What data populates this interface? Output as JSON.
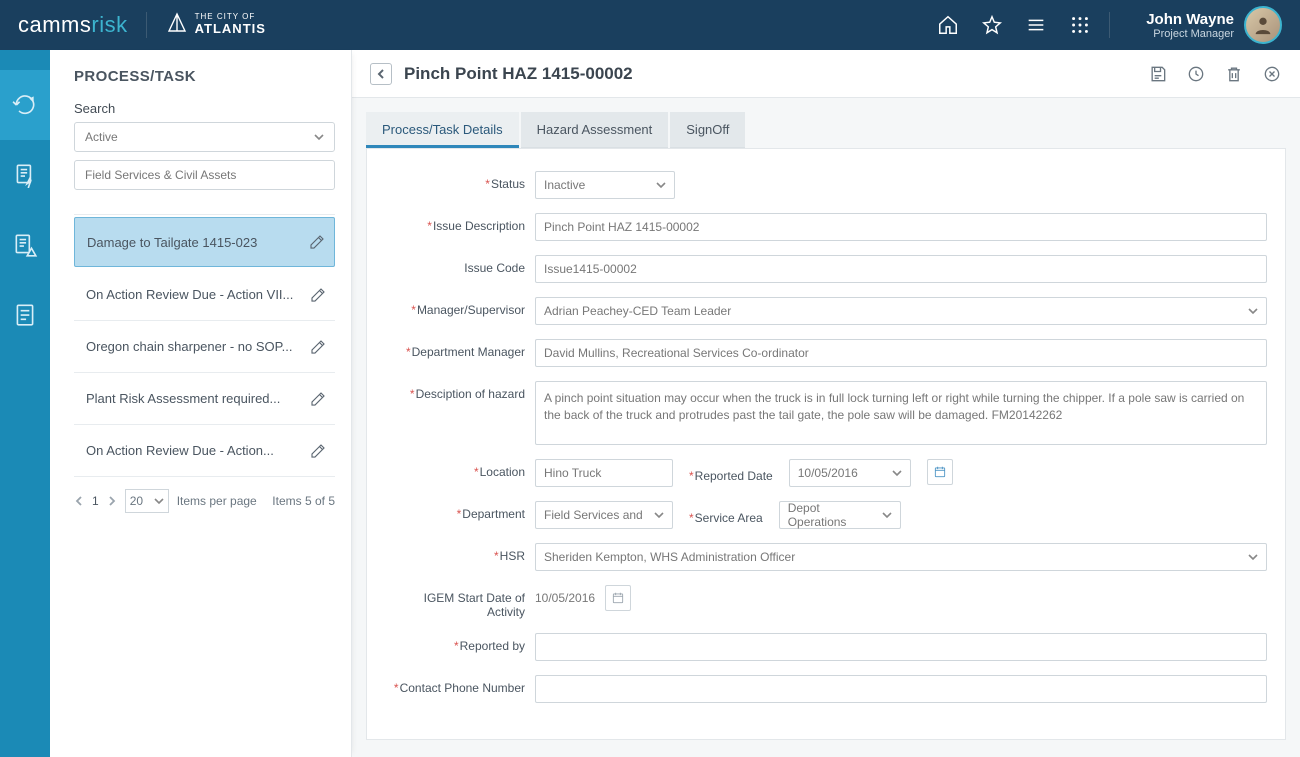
{
  "header": {
    "logo_left": "camms",
    "logo_right": "risk",
    "logo2_line1": "THE CITY OF",
    "logo2_line2": "ATLANTIS",
    "user_name": "John Wayne",
    "user_role": "Project Manager"
  },
  "sidebar": {
    "title": "PROCESS/TASK",
    "search_label": "Search",
    "status_filter": "Active",
    "text_filter": "Field Services & Civil Assets",
    "items": [
      {
        "label": "Damage to Tailgate 1415-023",
        "selected": true
      },
      {
        "label": "On Action Review Due - Action VII...",
        "selected": false
      },
      {
        "label": "Oregon chain sharpener - no SOP...",
        "selected": false
      },
      {
        "label": "Plant Risk Assessment required...",
        "selected": false
      },
      {
        "label": "On Action Review Due - Action...",
        "selected": false
      }
    ],
    "page_num": "1",
    "items_per_page": "20",
    "ipp_label": "Items per page",
    "summary": "Items 5 of 5"
  },
  "main": {
    "title": "Pinch Point HAZ 1415-00002",
    "tabs": [
      {
        "label": "Process/Task Details",
        "active": true
      },
      {
        "label": "Hazard Assessment",
        "active": false
      },
      {
        "label": "SignOff",
        "active": false
      }
    ]
  },
  "form": {
    "labels": {
      "status": "Status",
      "issue_desc": "Issue Description",
      "issue_code": "Issue Code",
      "manager": "Manager/Supervisor",
      "dept_manager": "Department Manager",
      "hazard_desc": "Desciption of hazard",
      "location": "Location",
      "reported_date": "Reported Date",
      "department": "Department",
      "service_area": "Service Area",
      "hsr": "HSR",
      "igem_start": "IGEM Start Date of Activity",
      "reported_by": "Reported by",
      "contact_phone": "Contact Phone Number"
    },
    "values": {
      "status": "Inactive",
      "issue_desc": "Pinch Point HAZ 1415-00002",
      "issue_code": "Issue1415-00002",
      "manager": "Adrian Peachey-CED Team Leader",
      "dept_manager": "David Mullins, Recreational Services Co-ordinator",
      "hazard_desc": "A pinch point situation may occur when the truck is in full lock turning left or right while turning the chipper. If a pole saw is carried on the back of the truck and protrudes past the tail gate, the pole saw will be damaged. FM20142262",
      "location": "Hino Truck",
      "reported_date": "10/05/2016",
      "department": "Field Services and",
      "service_area": "Depot Operations",
      "hsr": "Sheriden Kempton, WHS Administration Officer",
      "igem_start": "10/05/2016",
      "reported_by": "",
      "contact_phone": ""
    }
  }
}
